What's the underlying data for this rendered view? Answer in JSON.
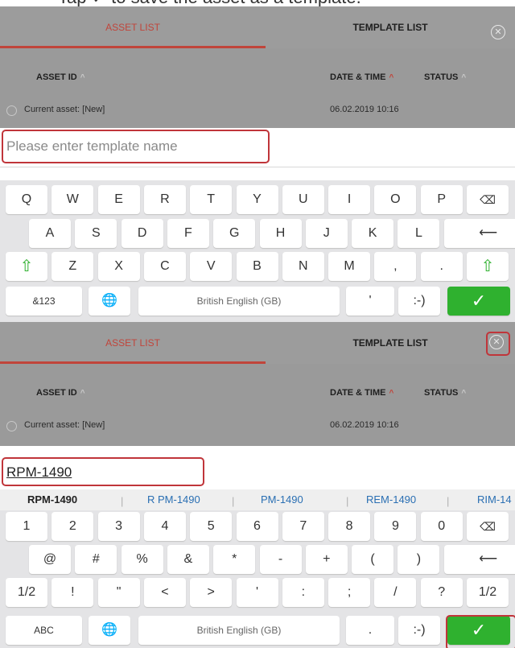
{
  "caption": "Tap ✓ to save the asset as a template.",
  "panels": [
    {
      "tabs": {
        "asset_list": "ASSET LIST",
        "template_list": "TEMPLATE LIST"
      },
      "columns": {
        "asset_id": "ASSET ID",
        "date_time": "DATE & TIME",
        "status": "STATUS"
      },
      "row": {
        "label": "Current asset: [New]",
        "date": "06.02.2019 10:16"
      },
      "input": {
        "placeholder": "Please enter template name",
        "value": ""
      },
      "keyboard": {
        "row1": [
          "Q",
          "W",
          "E",
          "R",
          "T",
          "Y",
          "U",
          "I",
          "O",
          "P",
          "⌫"
        ],
        "row2": [
          "A",
          "S",
          "D",
          "F",
          "G",
          "H",
          "J",
          "K",
          "L",
          "⟵"
        ],
        "row3": [
          "⇧",
          "Z",
          "X",
          "C",
          "V",
          "B",
          "N",
          "M",
          ",",
          ".",
          "⇧"
        ],
        "row4": {
          "mode": "&123",
          "globe": "🌐",
          "space": "British English (GB)",
          "apostrophe": "'",
          "smiley": ":-)",
          "done": "✓"
        }
      }
    },
    {
      "tabs": {
        "asset_list": "ASSET LIST",
        "template_list": "TEMPLATE LIST"
      },
      "columns": {
        "asset_id": "ASSET ID",
        "date_time": "DATE & TIME",
        "status": "STATUS"
      },
      "row": {
        "label": "Current asset: [New]",
        "date": "06.02.2019 10:16"
      },
      "input": {
        "placeholder": "",
        "value": "RPM-1490"
      },
      "suggestions": [
        "RPM-1490",
        "R PM-1490",
        "PM-1490",
        "REM-1490",
        "RIM-14"
      ],
      "keyboard": {
        "row1": [
          "1",
          "2",
          "3",
          "4",
          "5",
          "6",
          "7",
          "8",
          "9",
          "0",
          "⌫"
        ],
        "row2": [
          "@",
          "#",
          "%",
          "&",
          "*",
          "-",
          "+",
          "(",
          ")",
          "⟵"
        ],
        "row3": [
          "1/2",
          "!",
          "\"",
          "<",
          ">",
          "'",
          ":",
          ";",
          "/",
          "?",
          "1/2"
        ],
        "row4": {
          "mode": "ABC",
          "globe": "🌐",
          "space": "British English (GB)",
          "dot": ".",
          "smiley": ":-)",
          "done": "✓"
        }
      }
    }
  ],
  "colors": {
    "accent": "#c0453b",
    "done_green": "#2fb12f",
    "highlight": "#c0353a"
  }
}
